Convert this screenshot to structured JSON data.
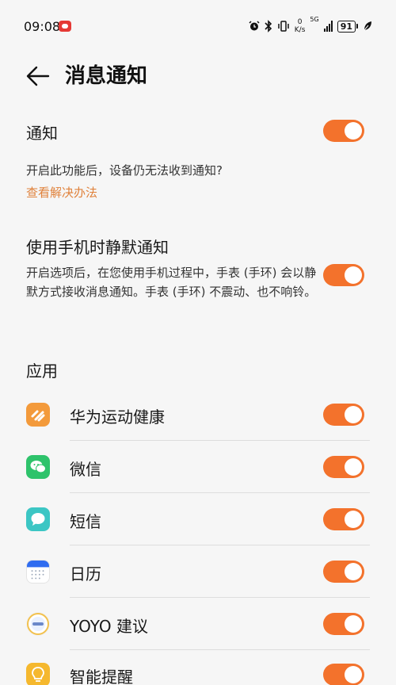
{
  "status_bar": {
    "time": "09:08",
    "speed_value": "0",
    "speed_unit": "K/s",
    "network": "5G",
    "battery": "91",
    "icons": [
      "alarm-icon",
      "bluetooth-icon",
      "vibrate-icon",
      "signal-icon",
      "battery-icon",
      "leaf-icon"
    ]
  },
  "header": {
    "title": "消息通知"
  },
  "notify": {
    "label": "通知",
    "enabled": true,
    "hint": "开启此功能后，设备仍无法收到通知?",
    "link": "查看解决办法"
  },
  "silent": {
    "label": "使用手机时静默通知",
    "description": "开启选项后，在您使用手机过程中，手表 (手环) 会以静默方式接收消息通知。手表 (手环) 不震动、也不响铃。",
    "enabled": true
  },
  "apps_section": {
    "title": "应用",
    "items": [
      {
        "name": "华为运动健康",
        "icon": "huawei-health-icon",
        "enabled": true
      },
      {
        "name": "微信",
        "icon": "wechat-icon",
        "enabled": true
      },
      {
        "name": "短信",
        "icon": "sms-icon",
        "enabled": true
      },
      {
        "name": "日历",
        "icon": "calendar-icon",
        "enabled": true
      },
      {
        "name": "YOYO 建议",
        "icon": "yoyo-icon",
        "enabled": true
      },
      {
        "name": "智能提醒",
        "icon": "smart-reminder-icon",
        "enabled": true
      }
    ]
  },
  "colors": {
    "accent": "#f3722c",
    "link": "#e0823c",
    "background": "#f6f6f6"
  }
}
